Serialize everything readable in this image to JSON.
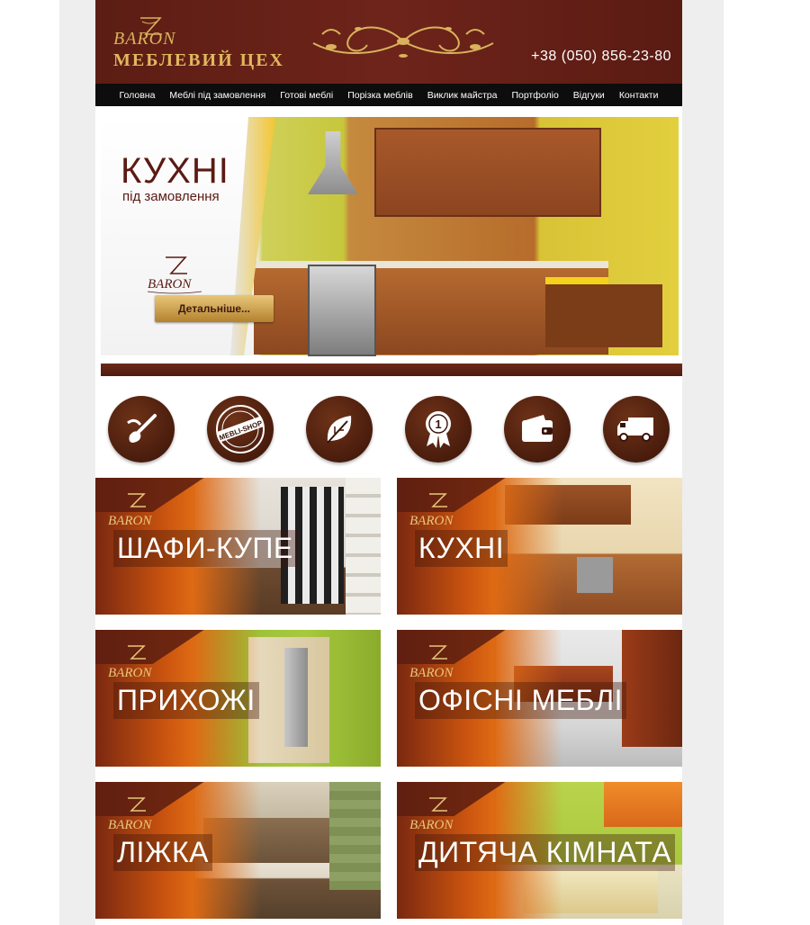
{
  "header": {
    "logo_baron": "BARON",
    "logo_subtitle": "МЕБЛЕВИЙ ЦЕХ",
    "phone": "+38 (050) 856-23-80"
  },
  "nav": {
    "items": [
      "Головна",
      "Меблі під замовлення",
      "Готові меблі",
      "Порізка меблів",
      "Виклик майстра",
      "Портфоліо",
      "Відгуки",
      "Контакти"
    ]
  },
  "hero": {
    "title": "КУХНІ",
    "subtitle": "під замовлення",
    "logo": "BARON",
    "button": "Детальніше..."
  },
  "features": {
    "icons": [
      "brush-icon",
      "mebli-shop-stamp-icon",
      "leaf-icon",
      "award-ribbon-icon",
      "wallet-icon",
      "delivery-truck-icon"
    ],
    "stamp_text": "MEBLI-SHOP"
  },
  "categories": [
    {
      "label": "ШАФИ-КУПЕ",
      "logo": "BARON",
      "photo_color": "#d9d4cc"
    },
    {
      "label": "КУХНІ",
      "logo": "BARON",
      "photo_color": "#c88a52"
    },
    {
      "label": "ПРИХОЖІ",
      "logo": "BARON",
      "photo_color": "#9cbf3a"
    },
    {
      "label": "ОФІСНІ МЕБЛІ",
      "logo": "BARON",
      "photo_color": "#b7b7b7"
    },
    {
      "label": "ЛІЖКА",
      "logo": "BARON",
      "photo_color": "#8a7a63"
    },
    {
      "label": "ДИТЯЧА КІМНАТА",
      "logo": "BARON",
      "photo_color": "#b8d34a"
    }
  ],
  "colors": {
    "brand_dark": "#5c1d14",
    "gold": "#d9b25c",
    "nav_bg": "#0d0d0d",
    "category_orange": "#de6a14"
  }
}
